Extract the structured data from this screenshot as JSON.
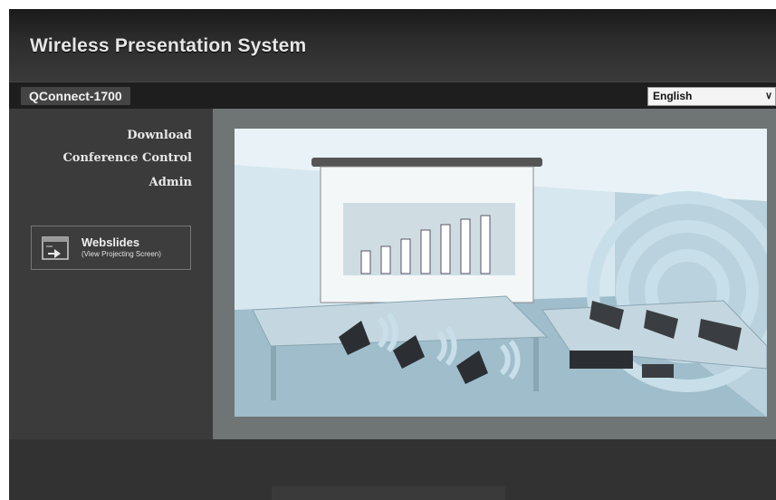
{
  "header": {
    "title": "Wireless Presentation System"
  },
  "device": {
    "name": "QConnect-1700"
  },
  "language": {
    "selected": "English"
  },
  "nav": {
    "items": [
      {
        "label": "Download"
      },
      {
        "label": "Conference Control"
      },
      {
        "label": "Admin"
      }
    ]
  },
  "webslides": {
    "title": "Webslides",
    "subtitle": "(View Projecting Screen)",
    "icon": "projector-screen-icon"
  },
  "colors": {
    "background": "#2b2b2b",
    "content_background": "#6f7474",
    "accent_blue": "#8fb3c6"
  }
}
